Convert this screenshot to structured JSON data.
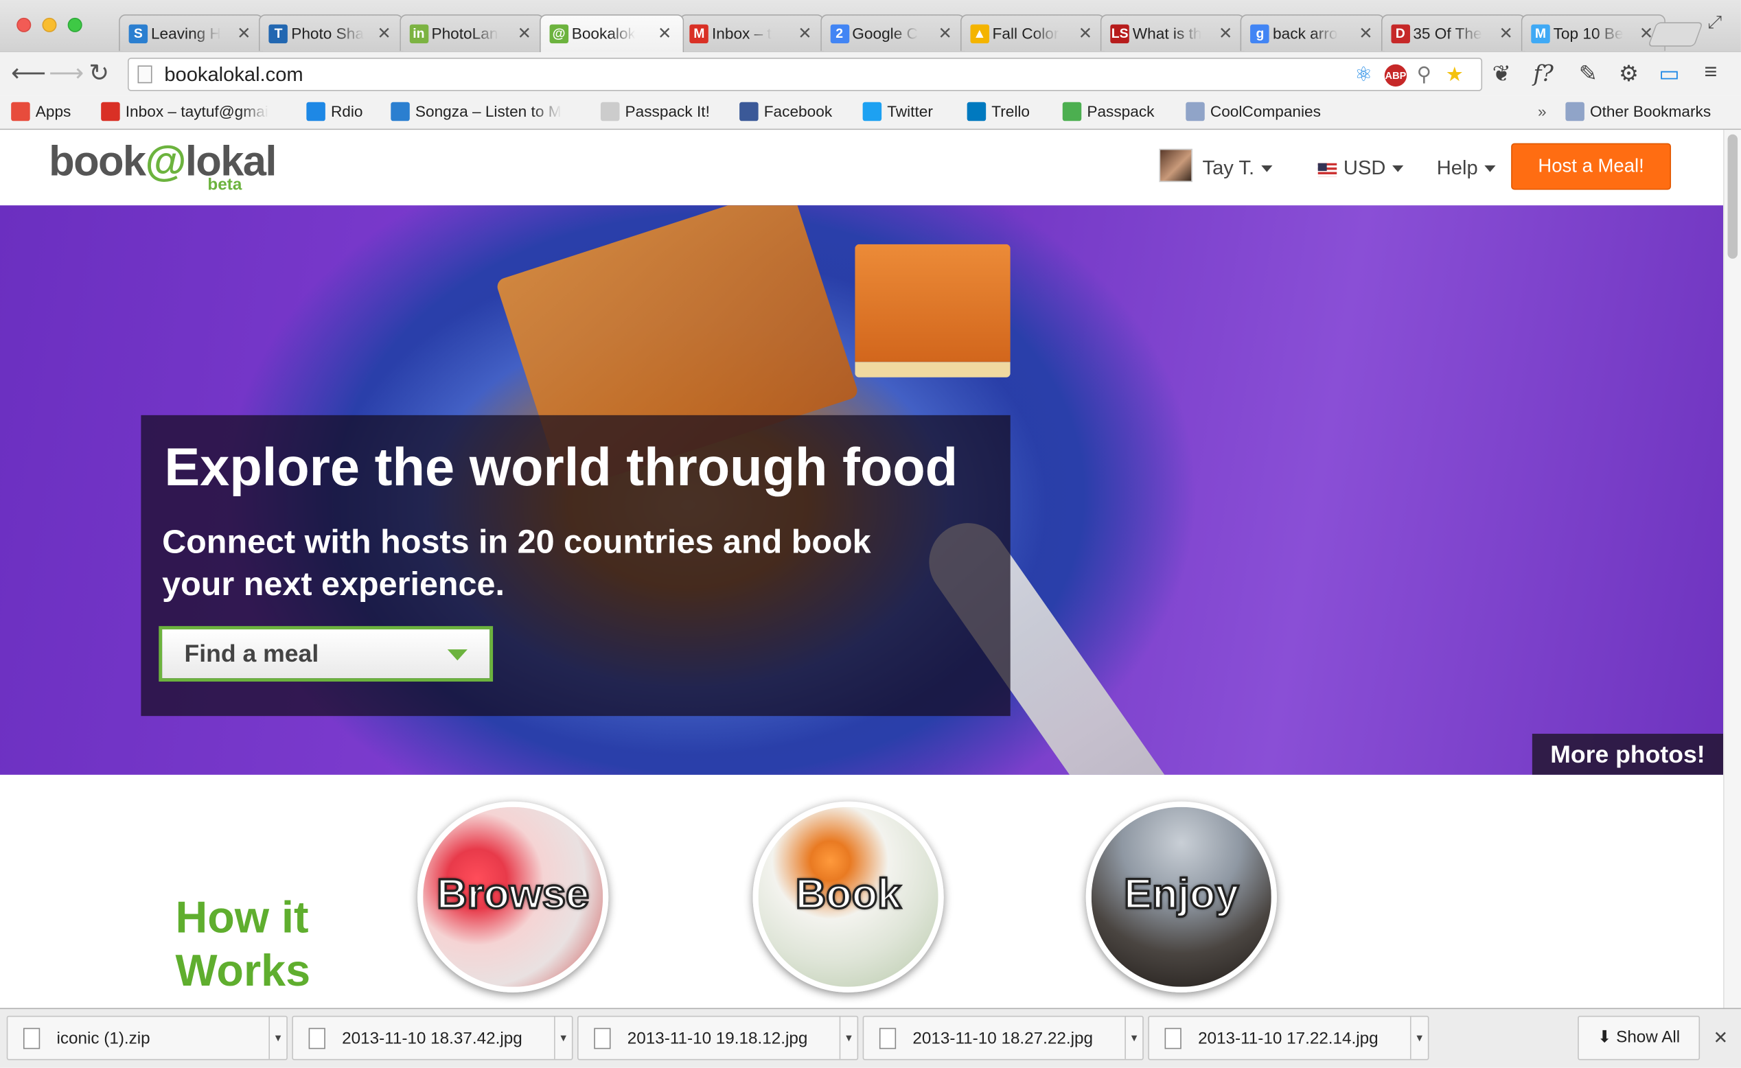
{
  "browser": {
    "tabs": [
      {
        "title": "Leaving H",
        "favicon": "S",
        "color": "#2b7fd0"
      },
      {
        "title": "Photo Sha",
        "favicon": "T",
        "color": "#2267b1"
      },
      {
        "title": "PhotoLan",
        "favicon": "in",
        "color": "#7cb342"
      },
      {
        "title": "Bookalok",
        "favicon": "@",
        "color": "#6cb33e",
        "active": true
      },
      {
        "title": "Inbox – t",
        "favicon": "M",
        "color": "#d93025"
      },
      {
        "title": "Google C",
        "favicon": "2",
        "color": "#4285f4"
      },
      {
        "title": "Fall Color",
        "favicon": "▲",
        "color": "#f4b400"
      },
      {
        "title": "What is th",
        "favicon": "LS",
        "color": "#b71c1c"
      },
      {
        "title": "back arro",
        "favicon": "g",
        "color": "#4285f4"
      },
      {
        "title": "35 Of The",
        "favicon": "D",
        "color": "#c62828"
      },
      {
        "title": "Top 10 Be",
        "favicon": "M",
        "color": "#3fa9f5"
      }
    ],
    "url": "bookalokal.com",
    "bookmarks": [
      {
        "label": "Apps",
        "icon": "apps-icon",
        "color": "#e74c3c"
      },
      {
        "label": "Inbox – taytuf@gmai",
        "icon": "gmail-icon",
        "color": "#d93025"
      },
      {
        "label": "Rdio",
        "icon": "rdio-icon",
        "color": "#1e88e5"
      },
      {
        "label": "Songza – Listen to M",
        "icon": "songza-icon",
        "color": "#2b7fd0"
      },
      {
        "label": "Passpack It!",
        "icon": "page-icon",
        "color": "#cccccc"
      },
      {
        "label": "Facebook",
        "icon": "facebook-icon",
        "color": "#3b5998"
      },
      {
        "label": "Twitter",
        "icon": "twitter-icon",
        "color": "#1da1f2"
      },
      {
        "label": "Trello",
        "icon": "trello-icon",
        "color": "#0079bf"
      },
      {
        "label": "Passpack",
        "icon": "passpack-icon",
        "color": "#4caf50"
      },
      {
        "label": "CoolCompanies",
        "icon": "folder-icon",
        "color": "#90a4c8"
      }
    ],
    "overflow_label": "»",
    "other_bookmarks": "Other Bookmarks"
  },
  "site": {
    "logo": {
      "book": "book",
      "at": "@",
      "lokal": "lokal",
      "beta": "beta"
    },
    "user_name": "Tay T.",
    "currency": "USD",
    "help": "Help",
    "host_button": "Host a Meal!",
    "hero": {
      "title": "Explore the world through food",
      "subtitle": "Connect with hosts in 20 countries and book your next experience.",
      "dropdown": "Find a meal",
      "more_photos": "More photos!"
    },
    "how_it_works": {
      "title_line1": "How it",
      "title_line2": "Works",
      "steps": [
        "Browse",
        "Book",
        "Enjoy"
      ]
    },
    "accent": "#6cb33e",
    "button_color": "#ff6d12"
  },
  "downloads": {
    "items": [
      "iconic (1).zip",
      "2013-11-10 18.37.42.jpg",
      "2013-11-10 19.18.12.jpg",
      "2013-11-10 18.27.22.jpg",
      "2013-11-10 17.22.14.jpg"
    ],
    "show_all": "Show All"
  }
}
